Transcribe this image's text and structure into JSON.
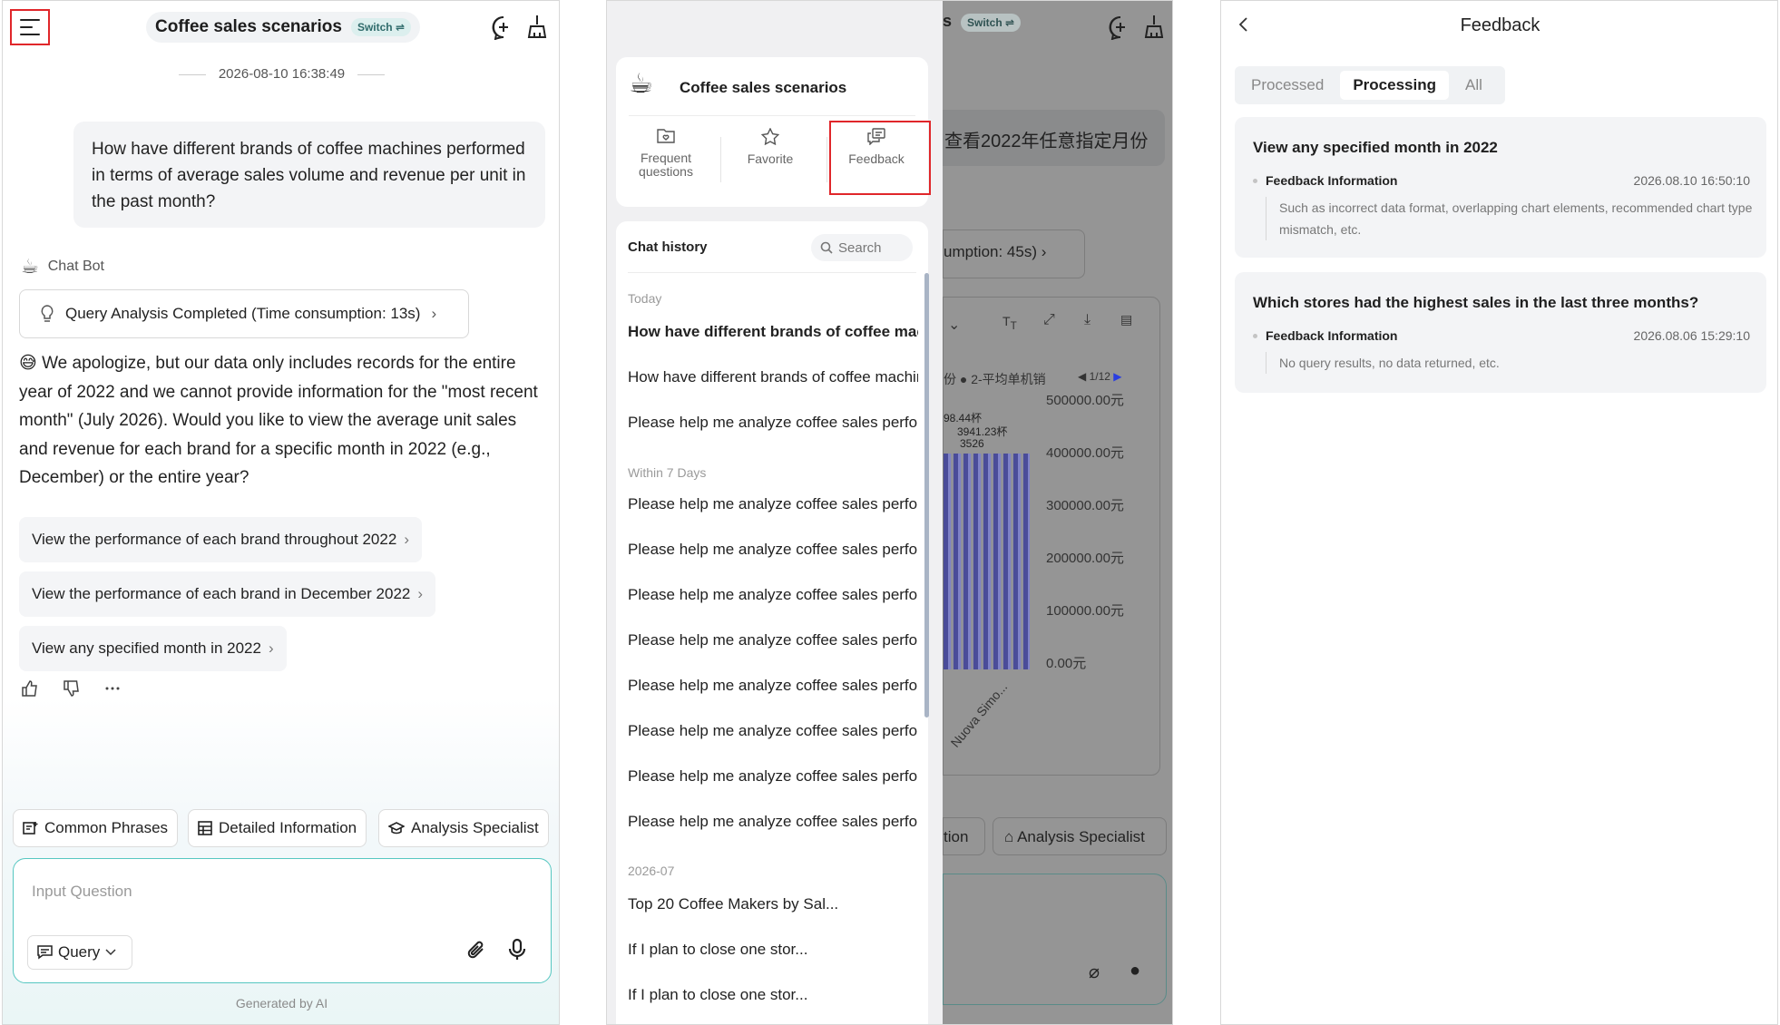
{
  "panel1": {
    "title": "Coffee sales scenarios",
    "switch_label": "Switch ⇌",
    "datetime": "2026-08-10 16:38:49",
    "user_question": "How have different brands of coffee machines performed in terms of average sales volume and revenue per unit in the past month?",
    "bot_name": "Chat Bot",
    "query_analysis": "Query Analysis Completed (Time consumption: 13s)",
    "answer_emoji": "😅",
    "answer": "We apologize, but our data only includes records for the entire year of 2022 and we cannot provide information for the \"most recent month\" (July 2026). Would you like to view the average unit sales and revenue for each brand for a specific month in 2022 (e.g., December) or the entire year?",
    "suggestions": [
      "View the performance of each brand throughout 2022",
      "View the performance of each brand in December 2022",
      "View any specified month in 2022"
    ],
    "toolbar": [
      "Common Phrases",
      "Detailed Information",
      "Analysis Specialist"
    ],
    "input_placeholder": "Input Question",
    "query_mode": "Query",
    "generated_by": "Generated by AI"
  },
  "panel2": {
    "scene_title": "Coffee sales scenarios",
    "tabs": [
      "Frequent questions",
      "Favorite",
      "Feedback"
    ],
    "chat_history_label": "Chat history",
    "search_placeholder": "Search",
    "sections": [
      {
        "label": "Today",
        "items": [
          "How have different brands of coffee machines performed",
          "How have different brands of coffee machines performed",
          "Please help me analyze coffee sales performance"
        ]
      },
      {
        "label": "Within 7 Days",
        "items": [
          "Please help me analyze coffee sales performance",
          "Please help me analyze coffee sales performance",
          "Please help me analyze coffee sales performance",
          "Please help me analyze coffee sales performance",
          "Please help me analyze coffee sales performance",
          "Please help me analyze coffee sales performance",
          "Please help me analyze coffee sales performance",
          "Please help me analyze coffee sales performance"
        ]
      },
      {
        "label": "2026-07",
        "items": [
          "Top 20 Coffee Makers by Sal...",
          "If I plan to close one stor...",
          "If I plan to close one stor..."
        ]
      }
    ],
    "bg": {
      "switch": "Switch ⇌",
      "question_fragment": "查看2022年任意指定月份",
      "time_fragment": "umption: 45s)",
      "legend": "份  ● 2-平均单机销",
      "page": "1/12",
      "yticks": [
        "500000.00元",
        "400000.00元",
        "300000.00元",
        "200000.00元",
        "100000.00元",
        "0.00元"
      ],
      "annotations": [
        "98.44杯",
        "3941.23杯",
        "3526"
      ],
      "xlabel": "Nuova Simo...",
      "tabs": [
        "tion",
        "Analysis Specialist"
      ]
    }
  },
  "panel3": {
    "title": "Feedback",
    "tabs": [
      "Processed",
      "Processing",
      "All"
    ],
    "active_tab": "Processing",
    "items": [
      {
        "title": "View any specified month in 2022",
        "label": "Feedback Information",
        "date": "2026.08.10 16:50:10",
        "desc": "Such as incorrect data format, overlapping chart elements, recommended chart type mismatch, etc."
      },
      {
        "title": "Which stores had the highest sales in the last three months?",
        "label": "Feedback Information",
        "date": "2026.08.06 15:29:10",
        "desc": "No query results, no data returned, etc."
      }
    ]
  },
  "colors": {
    "accent": "#56c7c1",
    "highlight": "#e0262a"
  }
}
